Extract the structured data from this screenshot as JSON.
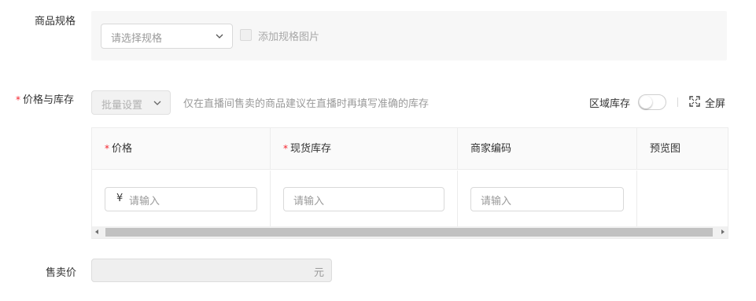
{
  "spec": {
    "label": "商品规格",
    "select_placeholder": "请选择规格",
    "add_image_label": "添加规格图片"
  },
  "price_stock": {
    "label": "价格与库存",
    "required_mark": "*",
    "batch_button_label": "批量设置",
    "hint": "仅在直播间售卖的商品建议在直播时再填写准确的库存",
    "region_stock_label": "区域库存",
    "region_stock_on": false,
    "fullscreen_label": "全屏"
  },
  "table": {
    "columns": [
      {
        "label": "价格",
        "required": true
      },
      {
        "label": "现货库存",
        "required": true
      },
      {
        "label": "商家编码",
        "required": false
      },
      {
        "label": "预览图",
        "required": false
      }
    ],
    "row": {
      "price_prefix": "¥",
      "price_placeholder": "请输入",
      "stock_placeholder": "请输入",
      "code_placeholder": "请输入"
    }
  },
  "sale_price": {
    "label": "售卖价",
    "unit": "元"
  },
  "colors": {
    "required": "#f5222d",
    "placeholder": "#9a9a9a",
    "border": "#d9d9d9"
  }
}
